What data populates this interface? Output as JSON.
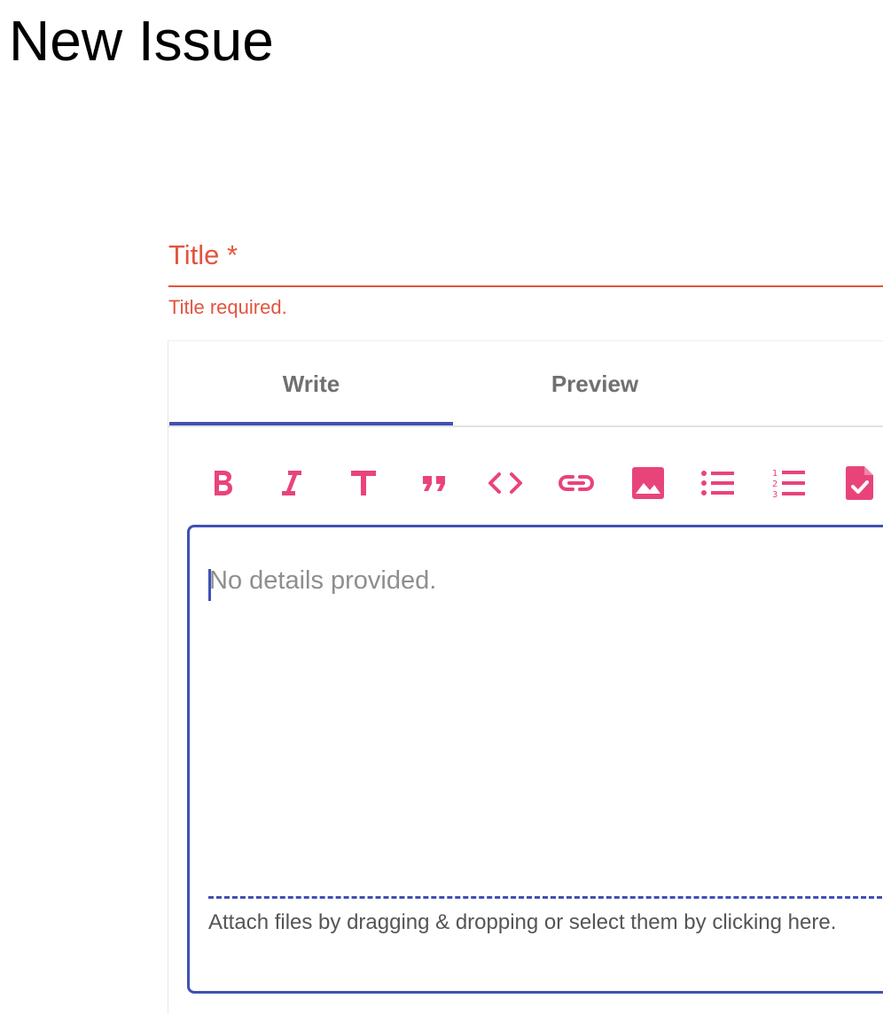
{
  "page": {
    "title": "New Issue"
  },
  "title_field": {
    "label": "Title *",
    "value": "",
    "error": "Title required."
  },
  "editor": {
    "tabs": [
      {
        "label": "Write",
        "selected": true
      },
      {
        "label": "Preview",
        "selected": false
      }
    ],
    "toolbar": [
      {
        "name": "bold-icon",
        "action": "bold"
      },
      {
        "name": "italic-icon",
        "action": "italic"
      },
      {
        "name": "header-icon",
        "action": "header"
      },
      {
        "name": "quote-icon",
        "action": "quote"
      },
      {
        "name": "code-icon",
        "action": "code"
      },
      {
        "name": "link-icon",
        "action": "link"
      },
      {
        "name": "image-icon",
        "action": "image"
      },
      {
        "name": "unordered-list-icon",
        "action": "unordered-list"
      },
      {
        "name": "ordered-list-icon",
        "action": "ordered-list"
      },
      {
        "name": "checked-list-icon",
        "action": "checked-list"
      }
    ],
    "placeholder": "No details provided.",
    "attach_text": "Attach files by dragging & dropping or select them by clicking here."
  },
  "colors": {
    "error": "#e2543f",
    "accent": "#3f51b5",
    "toolbar_icon": "#e9447a",
    "tab_text": "#707070",
    "placeholder": "#8e8e8e"
  }
}
